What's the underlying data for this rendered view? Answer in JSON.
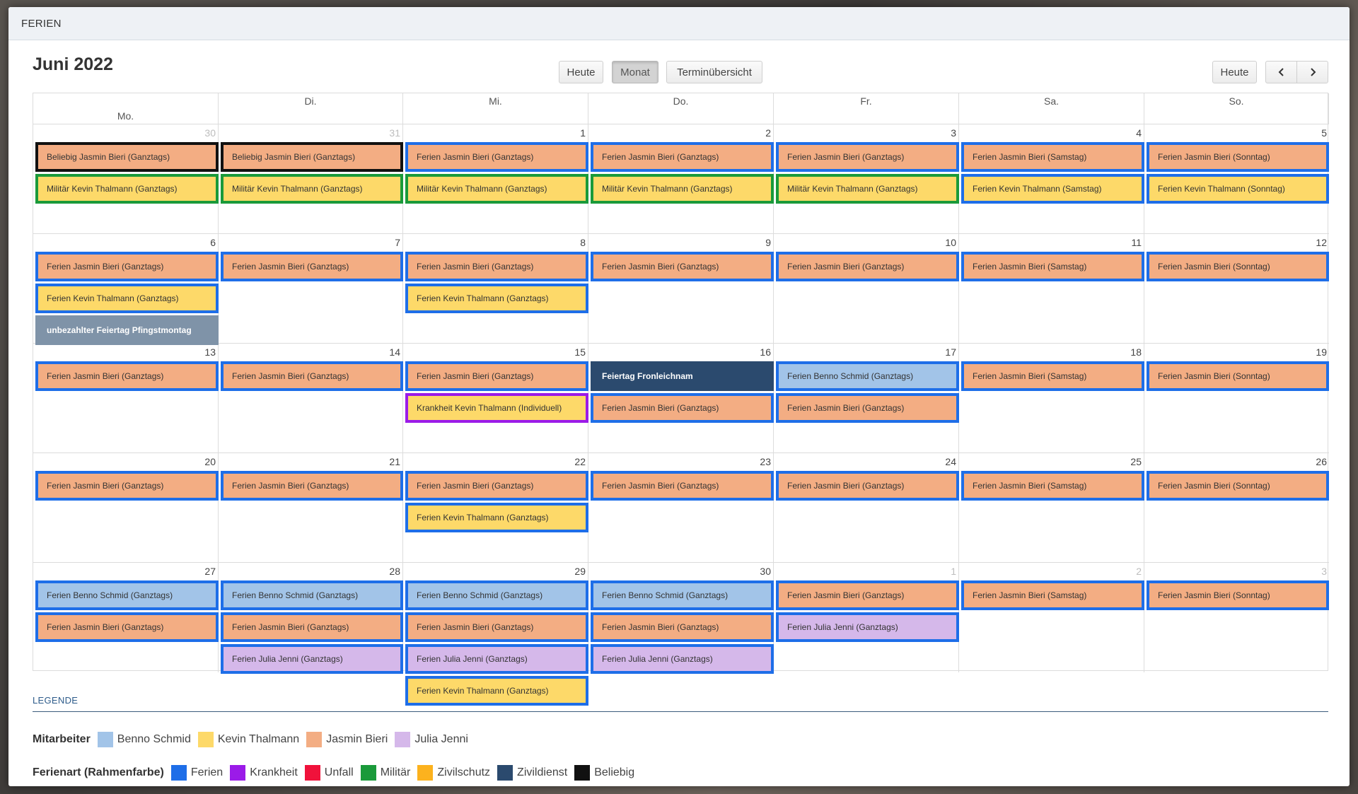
{
  "window": {
    "title": "FERIEN"
  },
  "toolbar": {
    "title": "Juni 2022",
    "today_left": "Heute",
    "month": "Monat",
    "overview": "Terminübersicht",
    "today_right": "Heute"
  },
  "colors": {
    "benno": "#a2c4e8",
    "kevin": "#fdd969",
    "jasmin": "#f3ad83",
    "julia": "#d5b8ea",
    "ferien": "#1e6ee8",
    "krankheit": "#9b1be8",
    "unfall": "#f0123b",
    "militaer": "#1a9a3a",
    "zivilschutz": "#fcb21e",
    "zivildienst": "#2b4a6e",
    "beliebig": "#111111",
    "holiday_gray": "#7f93a8"
  },
  "weekdays": [
    "Mo.",
    "Di.",
    "Mi.",
    "Do.",
    "Fr.",
    "Sa.",
    "So."
  ],
  "weeks": [
    {
      "days": [
        {
          "num": "30",
          "other": true,
          "events": [
            {
              "text": "Beliebig Jasmin Bieri (Ganztags)",
              "fill": "jasmin",
              "border": "beliebig"
            },
            {
              "text": "Militär Kevin Thalmann (Ganztags)",
              "fill": "kevin",
              "border": "militaer"
            }
          ]
        },
        {
          "num": "31",
          "other": true,
          "events": [
            {
              "text": "Beliebig Jasmin Bieri (Ganztags)",
              "fill": "jasmin",
              "border": "beliebig"
            },
            {
              "text": "Militär Kevin Thalmann (Ganztags)",
              "fill": "kevin",
              "border": "militaer"
            }
          ]
        },
        {
          "num": "1",
          "events": [
            {
              "text": "Ferien Jasmin Bieri (Ganztags)",
              "fill": "jasmin",
              "border": "ferien"
            },
            {
              "text": "Militär Kevin Thalmann (Ganztags)",
              "fill": "kevin",
              "border": "militaer"
            }
          ]
        },
        {
          "num": "2",
          "events": [
            {
              "text": "Ferien Jasmin Bieri (Ganztags)",
              "fill": "jasmin",
              "border": "ferien"
            },
            {
              "text": "Militär Kevin Thalmann (Ganztags)",
              "fill": "kevin",
              "border": "militaer"
            }
          ]
        },
        {
          "num": "3",
          "events": [
            {
              "text": "Ferien Jasmin Bieri (Ganztags)",
              "fill": "jasmin",
              "border": "ferien"
            },
            {
              "text": "Militär Kevin Thalmann (Ganztags)",
              "fill": "kevin",
              "border": "militaer"
            }
          ]
        },
        {
          "num": "4",
          "events": [
            {
              "text": "Ferien Jasmin Bieri (Samstag)",
              "fill": "jasmin",
              "border": "ferien"
            },
            {
              "text": "Ferien Kevin Thalmann (Samstag)",
              "fill": "kevin",
              "border": "ferien"
            }
          ]
        },
        {
          "num": "5",
          "events": [
            {
              "text": "Ferien Jasmin Bieri (Sonntag)",
              "fill": "jasmin",
              "border": "ferien"
            },
            {
              "text": "Ferien Kevin Thalmann (Sonntag)",
              "fill": "kevin",
              "border": "ferien"
            }
          ]
        }
      ]
    },
    {
      "days": [
        {
          "num": "6",
          "events": [
            {
              "text": "Ferien Jasmin Bieri (Ganztags)",
              "fill": "jasmin",
              "border": "ferien"
            },
            {
              "text": "Ferien Kevin Thalmann (Ganztags)",
              "fill": "kevin",
              "border": "ferien"
            },
            {
              "text": "unbezahlter Feiertag Pfingstmontag",
              "fill": "holiday_gray",
              "border": "holiday_gray",
              "bold": true
            }
          ]
        },
        {
          "num": "7",
          "events": [
            {
              "text": "Ferien Jasmin Bieri (Ganztags)",
              "fill": "jasmin",
              "border": "ferien"
            }
          ]
        },
        {
          "num": "8",
          "events": [
            {
              "text": "Ferien Jasmin Bieri (Ganztags)",
              "fill": "jasmin",
              "border": "ferien"
            },
            {
              "text": "Ferien Kevin Thalmann (Ganztags)",
              "fill": "kevin",
              "border": "ferien"
            }
          ]
        },
        {
          "num": "9",
          "events": [
            {
              "text": "Ferien Jasmin Bieri (Ganztags)",
              "fill": "jasmin",
              "border": "ferien"
            }
          ]
        },
        {
          "num": "10",
          "events": [
            {
              "text": "Ferien Jasmin Bieri (Ganztags)",
              "fill": "jasmin",
              "border": "ferien"
            }
          ]
        },
        {
          "num": "11",
          "events": [
            {
              "text": "Ferien Jasmin Bieri (Samstag)",
              "fill": "jasmin",
              "border": "ferien"
            }
          ]
        },
        {
          "num": "12",
          "events": [
            {
              "text": "Ferien Jasmin Bieri (Sonntag)",
              "fill": "jasmin",
              "border": "ferien"
            }
          ]
        }
      ]
    },
    {
      "days": [
        {
          "num": "13",
          "events": [
            {
              "text": "Ferien Jasmin Bieri (Ganztags)",
              "fill": "jasmin",
              "border": "ferien"
            }
          ]
        },
        {
          "num": "14",
          "events": [
            {
              "text": "Ferien Jasmin Bieri (Ganztags)",
              "fill": "jasmin",
              "border": "ferien"
            }
          ]
        },
        {
          "num": "15",
          "events": [
            {
              "text": "Ferien Jasmin Bieri (Ganztags)",
              "fill": "jasmin",
              "border": "ferien"
            },
            {
              "text": "Krankheit Kevin Thalmann (Individuell)",
              "fill": "kevin",
              "border": "krankheit"
            }
          ]
        },
        {
          "num": "16",
          "events": [
            {
              "text": "Feiertag Fronleichnam",
              "fill": "zivildienst",
              "border": "zivildienst",
              "bold": true
            },
            {
              "text": "Ferien Jasmin Bieri (Ganztags)",
              "fill": "jasmin",
              "border": "ferien"
            }
          ]
        },
        {
          "num": "17",
          "events": [
            {
              "text": "Ferien Benno Schmid (Ganztags)",
              "fill": "benno",
              "border": "ferien"
            },
            {
              "text": "Ferien Jasmin Bieri (Ganztags)",
              "fill": "jasmin",
              "border": "ferien"
            }
          ]
        },
        {
          "num": "18",
          "events": [
            {
              "text": "Ferien Jasmin Bieri (Samstag)",
              "fill": "jasmin",
              "border": "ferien"
            }
          ]
        },
        {
          "num": "19",
          "events": [
            {
              "text": "Ferien Jasmin Bieri (Sonntag)",
              "fill": "jasmin",
              "border": "ferien"
            }
          ]
        }
      ]
    },
    {
      "days": [
        {
          "num": "20",
          "events": [
            {
              "text": "Ferien Jasmin Bieri (Ganztags)",
              "fill": "jasmin",
              "border": "ferien"
            }
          ]
        },
        {
          "num": "21",
          "events": [
            {
              "text": "Ferien Jasmin Bieri (Ganztags)",
              "fill": "jasmin",
              "border": "ferien"
            }
          ]
        },
        {
          "num": "22",
          "events": [
            {
              "text": "Ferien Jasmin Bieri (Ganztags)",
              "fill": "jasmin",
              "border": "ferien"
            },
            {
              "text": "Ferien Kevin Thalmann (Ganztags)",
              "fill": "kevin",
              "border": "ferien"
            }
          ]
        },
        {
          "num": "23",
          "events": [
            {
              "text": "Ferien Jasmin Bieri (Ganztags)",
              "fill": "jasmin",
              "border": "ferien"
            }
          ]
        },
        {
          "num": "24",
          "events": [
            {
              "text": "Ferien Jasmin Bieri (Ganztags)",
              "fill": "jasmin",
              "border": "ferien"
            }
          ]
        },
        {
          "num": "25",
          "events": [
            {
              "text": "Ferien Jasmin Bieri (Samstag)",
              "fill": "jasmin",
              "border": "ferien"
            }
          ]
        },
        {
          "num": "26",
          "events": [
            {
              "text": "Ferien Jasmin Bieri (Sonntag)",
              "fill": "jasmin",
              "border": "ferien"
            }
          ]
        }
      ]
    },
    {
      "days": [
        {
          "num": "27",
          "events": [
            {
              "text": "Ferien Benno Schmid (Ganztags)",
              "fill": "benno",
              "border": "ferien"
            },
            {
              "text": "Ferien Jasmin Bieri (Ganztags)",
              "fill": "jasmin",
              "border": "ferien"
            }
          ]
        },
        {
          "num": "28",
          "events": [
            {
              "text": "Ferien Benno Schmid (Ganztags)",
              "fill": "benno",
              "border": "ferien"
            },
            {
              "text": "Ferien Jasmin Bieri (Ganztags)",
              "fill": "jasmin",
              "border": "ferien"
            },
            {
              "text": "Ferien Julia Jenni (Ganztags)",
              "fill": "julia",
              "border": "ferien"
            }
          ]
        },
        {
          "num": "29",
          "events": [
            {
              "text": "Ferien Benno Schmid (Ganztags)",
              "fill": "benno",
              "border": "ferien"
            },
            {
              "text": "Ferien Jasmin Bieri (Ganztags)",
              "fill": "jasmin",
              "border": "ferien"
            },
            {
              "text": "Ferien Julia Jenni (Ganztags)",
              "fill": "julia",
              "border": "ferien"
            },
            {
              "text": "Ferien Kevin Thalmann (Ganztags)",
              "fill": "kevin",
              "border": "ferien"
            }
          ]
        },
        {
          "num": "30",
          "events": [
            {
              "text": "Ferien Benno Schmid (Ganztags)",
              "fill": "benno",
              "border": "ferien"
            },
            {
              "text": "Ferien Jasmin Bieri (Ganztags)",
              "fill": "jasmin",
              "border": "ferien"
            },
            {
              "text": "Ferien Julia Jenni (Ganztags)",
              "fill": "julia",
              "border": "ferien"
            }
          ]
        },
        {
          "num": "1",
          "other": true,
          "events": [
            {
              "text": "Ferien Jasmin Bieri (Ganztags)",
              "fill": "jasmin",
              "border": "ferien"
            },
            {
              "text": "Ferien Julia Jenni (Ganztags)",
              "fill": "julia",
              "border": "ferien"
            }
          ]
        },
        {
          "num": "2",
          "other": true,
          "events": [
            {
              "text": "Ferien Jasmin Bieri (Samstag)",
              "fill": "jasmin",
              "border": "ferien"
            }
          ]
        },
        {
          "num": "3",
          "other": true,
          "events": [
            {
              "text": "Ferien Jasmin Bieri (Sonntag)",
              "fill": "jasmin",
              "border": "ferien"
            }
          ]
        }
      ]
    }
  ],
  "legend": {
    "title": "LEGENDE",
    "employees_label": "Mitarbeiter",
    "employees": [
      {
        "name": "Benno Schmid",
        "color": "benno"
      },
      {
        "name": "Kevin Thalmann",
        "color": "kevin"
      },
      {
        "name": "Jasmin Bieri",
        "color": "jasmin"
      },
      {
        "name": "Julia Jenni",
        "color": "julia"
      }
    ],
    "types_label": "Ferienart (Rahmenfarbe)",
    "types": [
      {
        "name": "Ferien",
        "color": "ferien"
      },
      {
        "name": "Krankheit",
        "color": "krankheit"
      },
      {
        "name": "Unfall",
        "color": "unfall"
      },
      {
        "name": "Militär",
        "color": "militaer"
      },
      {
        "name": "Zivilschutz",
        "color": "zivilschutz"
      },
      {
        "name": "Zivildienst",
        "color": "zivildienst"
      },
      {
        "name": "Beliebig",
        "color": "beliebig"
      }
    ]
  }
}
